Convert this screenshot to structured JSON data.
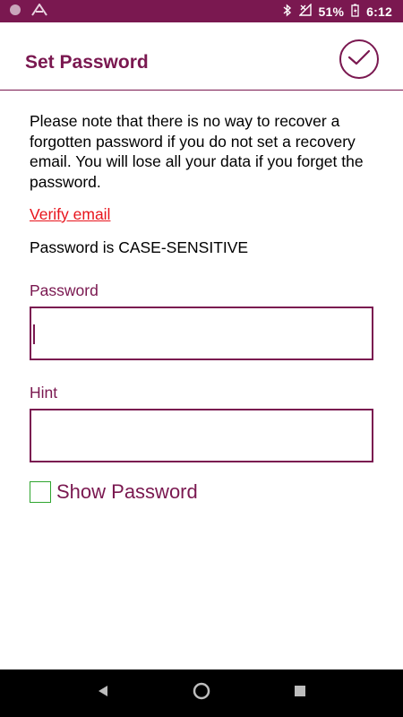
{
  "status_bar": {
    "battery_text": "51%",
    "time": "6:12",
    "icons": [
      "record-icon",
      "app-logo-icon",
      "bluetooth-icon",
      "signal-off-icon",
      "battery-icon"
    ]
  },
  "app_bar": {
    "title": "Set Password",
    "confirm_icon": "check-circle-icon"
  },
  "content": {
    "note": "Please note that there is no way to recover a forgotten password if you do not set a recovery email. You will lose all your data if you forget the password.",
    "verify_link": "Verify email",
    "case_note": "Password is CASE-SENSITIVE",
    "password": {
      "label": "Password",
      "value": ""
    },
    "hint": {
      "label": "Hint",
      "value": ""
    },
    "show_password": {
      "label": "Show Password",
      "checked": false
    }
  },
  "nav_bar": {
    "buttons": [
      "back-icon",
      "home-icon",
      "recents-icon"
    ]
  },
  "colors": {
    "accent": "#7a1850",
    "link": "#e8141c",
    "checkbox": "#2fa52f"
  }
}
